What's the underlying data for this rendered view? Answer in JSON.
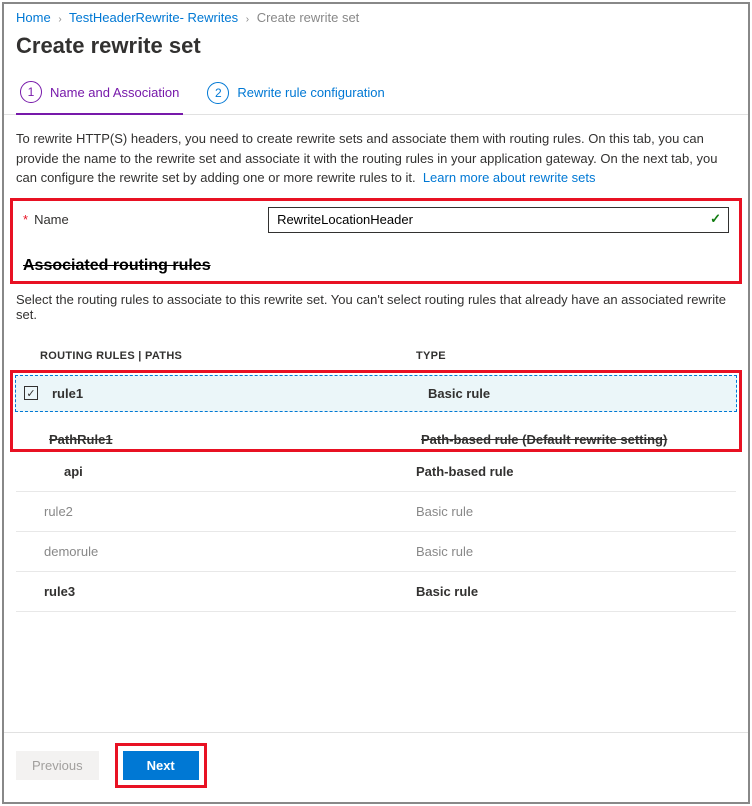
{
  "breadcrumb": {
    "home": "Home",
    "section": "TestHeaderRewrite- Rewrites",
    "current": "Create rewrite set"
  },
  "title": "Create rewrite set",
  "tabs": {
    "tab1_num": "1",
    "tab1_label": "Name and Association",
    "tab2_num": "2",
    "tab2_label": "Rewrite rule configuration"
  },
  "description": "To rewrite HTTP(S) headers, you need to create rewrite sets and associate them with routing rules. On this tab, you can provide the name to the rewrite set and associate it with the routing rules in your application gateway. On the next tab, you can configure the rewrite set by adding one or more rewrite rules to it.",
  "learn_link": "Learn more about rewrite sets",
  "name_field": {
    "label": "Name",
    "value": "RewriteLocationHeader"
  },
  "section_heading": "Associated routing rules",
  "section_sub": "Select the routing rules to associate to this rewrite set. You can't select routing rules that already have an associated rewrite set.",
  "table": {
    "col1": "ROUTING RULES | PATHS",
    "col2": "TYPE",
    "rows": [
      {
        "name": "rule1",
        "type": "Basic rule",
        "selected": true,
        "bold": true
      },
      {
        "name": "PathRule1",
        "type": "Path-based rule (Default rewrite setting)",
        "struck": true
      },
      {
        "name": "api",
        "type": "Path-based rule",
        "indent": true,
        "bold": true
      },
      {
        "name": "rule2",
        "type": "Basic rule",
        "dim": true
      },
      {
        "name": "demorule",
        "type": "Basic rule",
        "dim": true
      },
      {
        "name": "rule3",
        "type": "Basic rule",
        "bold": true
      }
    ]
  },
  "footer": {
    "prev": "Previous",
    "next": "Next"
  }
}
